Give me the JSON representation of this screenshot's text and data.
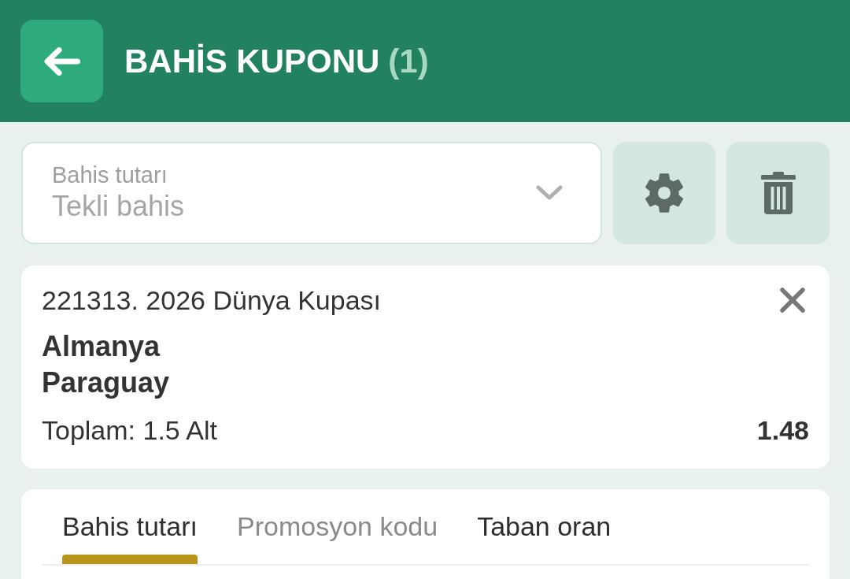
{
  "header": {
    "title": "BAHİS KUPONU",
    "count": "(1)"
  },
  "stake_select": {
    "label": "Bahis tutarı",
    "value": "Tekli bahis",
    "disabled": true
  },
  "bet": {
    "event": "221313. 2026 Dünya Kupası",
    "teams": [
      "Almanya",
      "Paraguay"
    ],
    "market": "Toplam: 1.5 Alt",
    "odds": "1.48"
  },
  "tabs": [
    {
      "label": "Bahis tutarı",
      "selected": true,
      "disabled": false
    },
    {
      "label": "Promosyon kodu",
      "selected": false,
      "disabled": true
    },
    {
      "label": "Taban oran",
      "selected": false,
      "disabled": false
    }
  ]
}
